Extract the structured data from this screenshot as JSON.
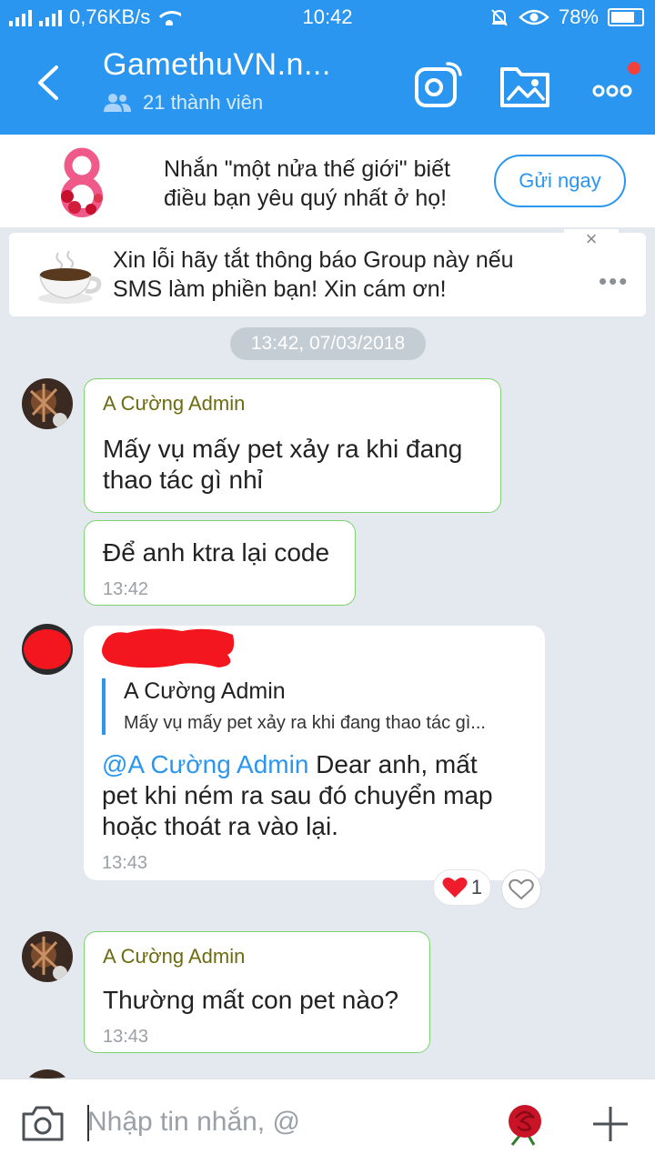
{
  "status_bar": {
    "network_speed": "0,76KB/s",
    "time": "10:42",
    "battery_percent": "78%",
    "battery_level": 0.78
  },
  "header": {
    "title": "GamethuVN.n...",
    "members": "21 thành viên",
    "icons": [
      "back-icon",
      "camera-live-icon",
      "gallery-folder-icon",
      "more-icon"
    ],
    "accent": "#2a96f0",
    "notification_dot_color": "#f2413d"
  },
  "promo": {
    "text_line1": "Nhắn \"một nửa thế giới\" biết",
    "text_line2": "điều bạn yêu quý nhất ở họ!",
    "button": "Gửi ngay"
  },
  "notice": {
    "line1": "Xin lỗi hãy tắt thông báo Group này nếu",
    "line2": "SMS làm phiền bạn! Xin cám ơn!",
    "close": "×",
    "more": "•••"
  },
  "date_separator": "13:42, 07/03/2018",
  "messages": [
    {
      "sender": "A Cường Admin",
      "line1": "Mấy vụ mấy pet xảy ra khi đang",
      "line2": "thao tác gì nhỉ"
    },
    {
      "line1": "Để anh ktra lại code",
      "time": "13:42"
    },
    {
      "quote_name": "A Cường Admin",
      "quote_text": "Mấy vụ mấy pet xảy ra khi đang thao tác gì...",
      "mention": "@A Cường Admin",
      "line1_rest": " Dear anh, mất",
      "line2": "pet khi ném ra  sau đó chuyển map",
      "line3": "hoặc thoát ra vào lại.",
      "time": "13:43",
      "heart_count": "1"
    },
    {
      "sender": "A Cường Admin",
      "line1": "Thường mất con pet nào?",
      "time": "13:43"
    }
  ],
  "input": {
    "placeholder": "Nhập tin nhắn, @",
    "icons": [
      "camera-icon",
      "rose-sticker-icon",
      "plus-icon"
    ]
  }
}
